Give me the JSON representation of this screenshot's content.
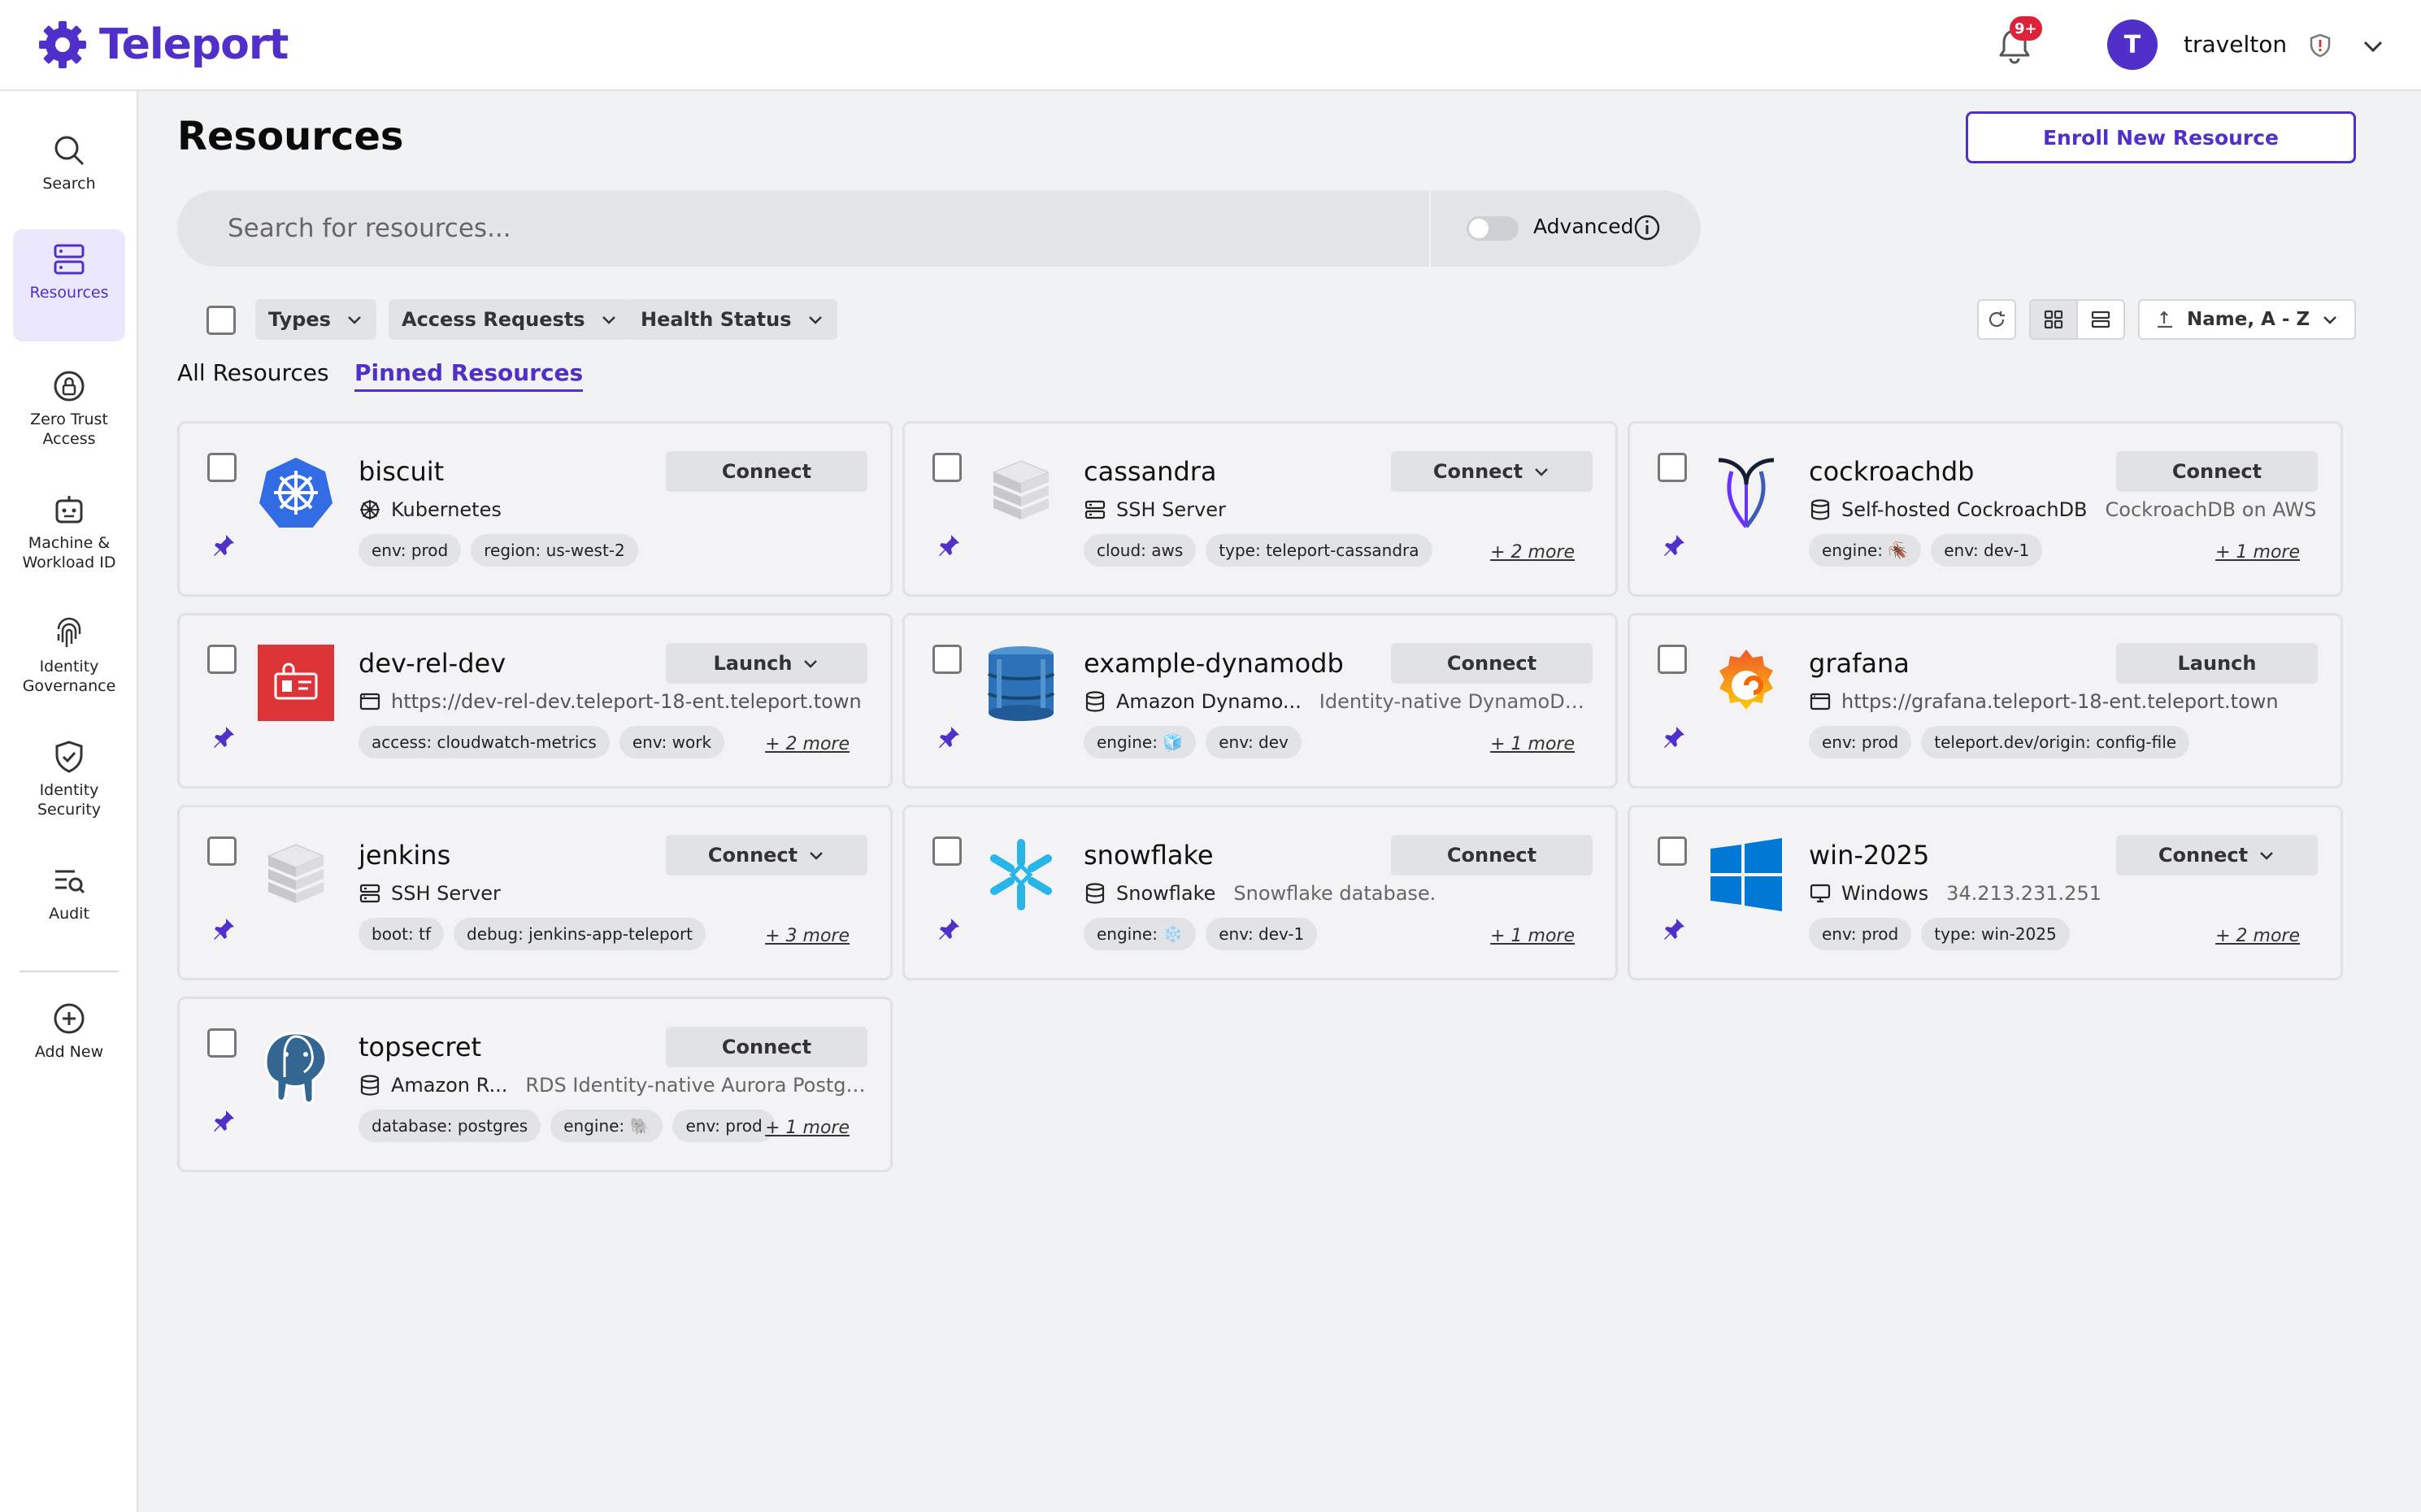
{
  "brand": {
    "name": "Teleport",
    "color": "#512fc9"
  },
  "topbar": {
    "notification_count": "9+",
    "avatar_initial": "T",
    "username": "travelton"
  },
  "sidebar": {
    "items": [
      {
        "label": "Search",
        "icon": "search-icon"
      },
      {
        "label": "Resources",
        "icon": "server-icon",
        "active": true
      },
      {
        "label": "Zero Trust Access",
        "icon": "lock-circle-icon"
      },
      {
        "label": "Machine & Workload ID",
        "icon": "robot-icon"
      },
      {
        "label": "Identity Governance",
        "icon": "fingerprint-icon"
      },
      {
        "label": "Identity Security",
        "icon": "shield-check-icon"
      },
      {
        "label": "Audit",
        "icon": "audit-list-icon"
      },
      {
        "label": "Add New",
        "icon": "plus-circle-icon"
      }
    ]
  },
  "main": {
    "title": "Resources",
    "enroll_label": "Enroll New Resource",
    "search_placeholder": "Search for resources...",
    "advanced_label": "Advanced",
    "filters": [
      "Types",
      "Access Requests",
      "Health Status"
    ],
    "sort_label": "Name, A - Z",
    "tabs": [
      "All Resources",
      "Pinned Resources"
    ],
    "active_tab": "Pinned Resources"
  },
  "resources": [
    {
      "name": "biscuit",
      "action": "Connect",
      "dropdown": false,
      "kind": "Kubernetes",
      "kind_icon": "kubernetes-icon",
      "description": "",
      "labels": [
        "env: prod",
        "region: us-west-2"
      ],
      "more": ""
    },
    {
      "name": "cassandra",
      "action": "Connect",
      "dropdown": true,
      "kind": "SSH Server",
      "kind_icon": "server-icon",
      "description": "",
      "labels": [
        "cloud: aws",
        "type: teleport-cassandra"
      ],
      "more": "+ 2 more"
    },
    {
      "name": "cockroachdb",
      "action": "Connect",
      "dropdown": false,
      "kind": "Self-hosted CockroachDB",
      "kind_icon": "database-icon",
      "description": "CockroachDB on AWS",
      "labels": [
        "engine: 🪳",
        "env: dev-1"
      ],
      "more": "+ 1 more"
    },
    {
      "name": "dev-rel-dev",
      "action": "Launch",
      "dropdown": true,
      "kind": "https://dev-rel-dev.teleport-18-ent.teleport.town",
      "kind_icon": "application-icon",
      "description": "",
      "labels": [
        "access: cloudwatch-metrics",
        "env: work"
      ],
      "more": "+ 2 more"
    },
    {
      "name": "example-dynamodb",
      "action": "Connect",
      "dropdown": false,
      "kind": "Amazon Dynamo...",
      "kind_icon": "database-icon",
      "description": "Identity-native DynamoDB Ac...",
      "labels": [
        "engine: 🧊",
        "env: dev"
      ],
      "more": "+ 1 more"
    },
    {
      "name": "grafana",
      "action": "Launch",
      "dropdown": false,
      "kind": "https://grafana.teleport-18-ent.teleport.town",
      "kind_icon": "application-icon",
      "description": "",
      "labels": [
        "env: prod",
        "teleport.dev/origin: config-file"
      ],
      "more": ""
    },
    {
      "name": "jenkins",
      "action": "Connect",
      "dropdown": true,
      "kind": "SSH Server",
      "kind_icon": "server-icon",
      "description": "",
      "labels": [
        "boot: tf",
        "debug: jenkins-app-teleport"
      ],
      "more": "+ 3 more"
    },
    {
      "name": "snowflake",
      "action": "Connect",
      "dropdown": false,
      "kind": "Snowflake",
      "kind_icon": "database-icon",
      "description": "Snowflake database.",
      "labels": [
        "engine: ❄️",
        "env: dev-1"
      ],
      "more": "+ 1 more"
    },
    {
      "name": "win-2025",
      "action": "Connect",
      "dropdown": true,
      "kind": "Windows",
      "kind_icon": "desktop-icon",
      "description": "34.213.231.251",
      "labels": [
        "env: prod",
        "type: win-2025"
      ],
      "more": "+ 2 more"
    },
    {
      "name": "topsecret",
      "action": "Connect",
      "dropdown": false,
      "kind": "Amazon R...",
      "kind_icon": "database-icon",
      "description": "RDS Identity-native Aurora Postgres ...",
      "labels": [
        "database: postgres",
        "engine: 🐘",
        "env: prod"
      ],
      "more": "+ 1 more"
    }
  ]
}
